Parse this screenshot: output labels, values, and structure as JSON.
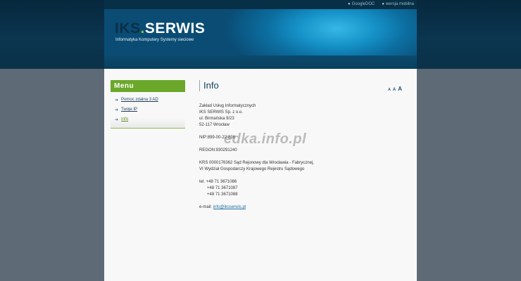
{
  "top_links": [
    {
      "label": "GoogleDOC"
    },
    {
      "label": "wersja mobilna"
    }
  ],
  "header": {
    "logo_part1": "IKS",
    "logo_dot": ".",
    "logo_part2": "SERWIS",
    "tagline": "Informatyka Komputery Systemy sieciowe"
  },
  "menu": {
    "title": "Menu",
    "items": [
      {
        "label": "Pomoc zdalna 3 AD"
      },
      {
        "label": "Twoje IP"
      },
      {
        "label": "Info"
      }
    ]
  },
  "main": {
    "title": "Info",
    "font_size_controls": [
      "A",
      "A",
      "A"
    ],
    "address": [
      "Zakład Usług Informatycznych",
      "IKS SERWIS Sp. z o.o.",
      "ul. Birmańska 9/23",
      "52-117 Wrocław"
    ],
    "nip": "NIP:899-00-22-836",
    "regon": "REGON:930291240",
    "krs": [
      "KRS 0000176362 Sąd Rejonowy dla Wrocławia - Fabrycznej,",
      "VI Wydział Gospodarczy Krajowego Rejestru Sądowego"
    ],
    "tel_label": "tel.",
    "phones": [
      "+48 71 3671086",
      "+48 71 3671087",
      "+48 71 3671088"
    ],
    "email_label": "e-mail:",
    "email": "info@iksserwis.pl"
  },
  "watermark": "edka.info.pl"
}
